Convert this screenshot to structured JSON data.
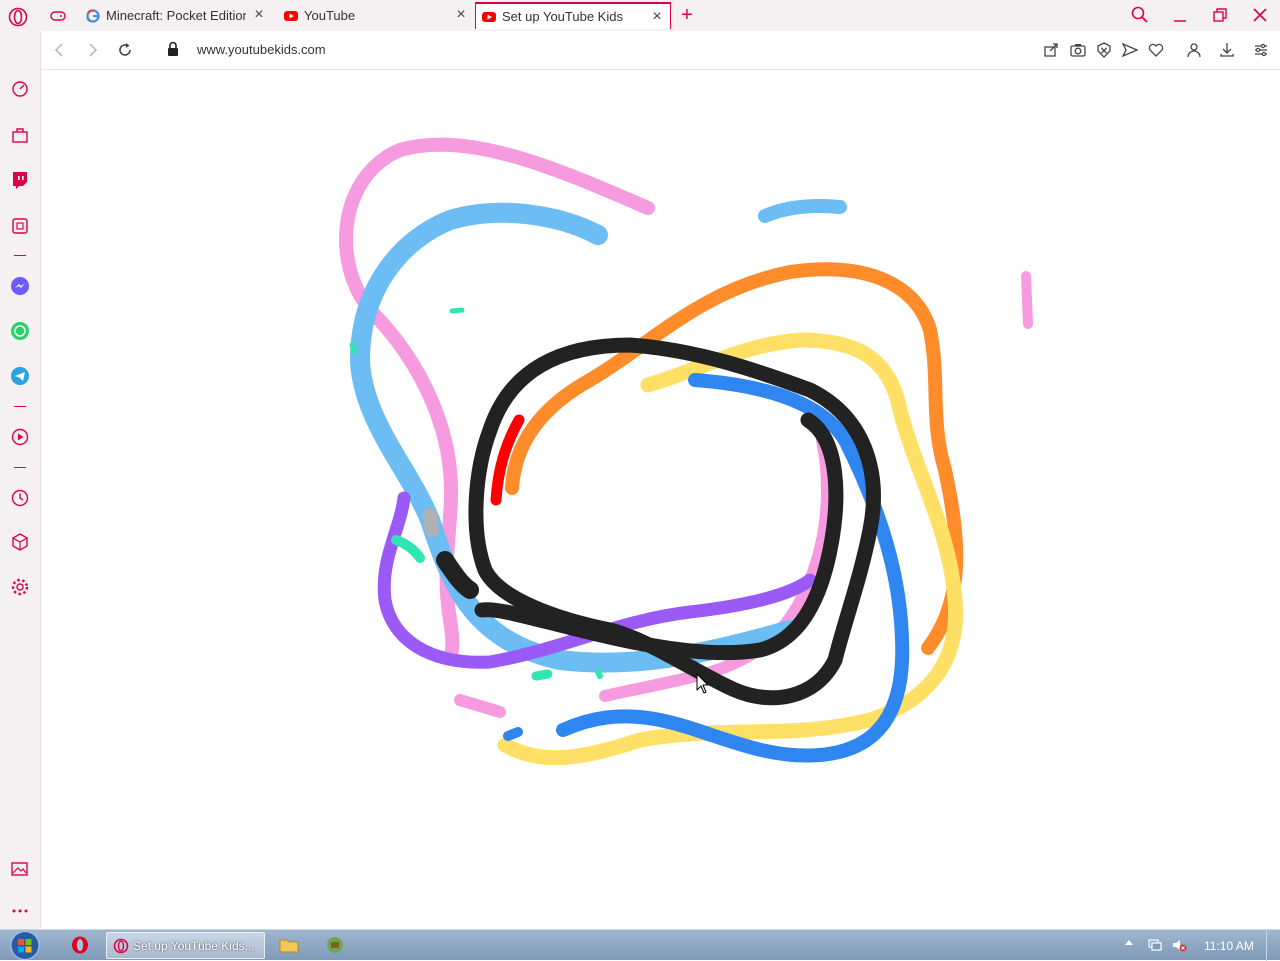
{
  "browser": {
    "tabs": [
      {
        "title": "Minecraft: Pocket Edition -",
        "favicon": "google-icon"
      },
      {
        "title": "YouTube",
        "favicon": "youtube-icon"
      },
      {
        "title": "Set up YouTube Kids",
        "favicon": "youtube-icon",
        "active": true
      }
    ],
    "url": "www.youtubekids.com",
    "accent": "#e0004a"
  },
  "taskbar": {
    "active_task": "Set up YouTube Kids...",
    "clock": "11:10 AM"
  },
  "drawing": {
    "stroke_colors": [
      "#f79be0",
      "#6bbdf3",
      "#ff8c2a",
      "#ffe066",
      "#2f86f0",
      "#9b59f5",
      "#222222",
      "#ff0000",
      "#2ee6b0"
    ]
  }
}
